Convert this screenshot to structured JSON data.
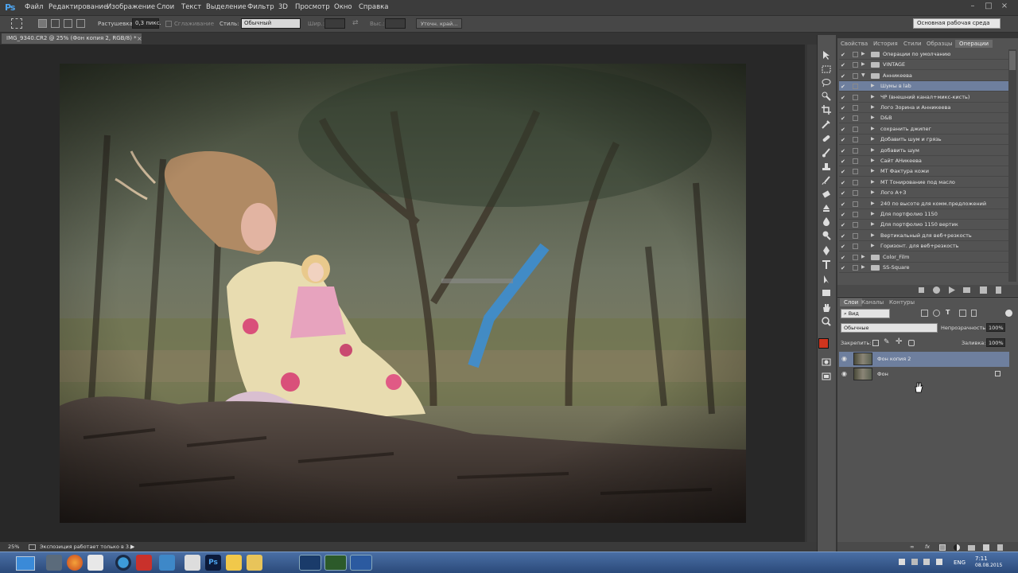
{
  "app": {
    "logo": "Ps"
  },
  "menu": [
    "Файл",
    "Редактирование",
    "Изображение",
    "Слои",
    "Текст",
    "Выделение",
    "Фильтр",
    "3D",
    "Просмотр",
    "Окно",
    "Справка"
  ],
  "options": {
    "feather_label": "Растушевка:",
    "feather_value": "0,3 пикс.",
    "antialias_label": "Сглаживание",
    "style_label": "Стиль:",
    "style_value": "Обычный",
    "width_label": "Шир.:",
    "height_label": "Выс.:",
    "refine_button": "Уточн. край...",
    "workspace": "Основная рабочая среда"
  },
  "document": {
    "tab_title": "IMG_9340.CR2 @ 25% (Фон копия 2, RGB/8) *",
    "close": "×"
  },
  "status": {
    "zoom": "25%",
    "message": "Экспозиция работает только в 3..."
  },
  "panel_tabs": [
    "Свойства",
    "История",
    "Стили",
    "Образцы",
    "Операции"
  ],
  "actions": [
    {
      "name": "Операции по умолчанию",
      "level": 0,
      "set": true,
      "open": false
    },
    {
      "name": "VINTAGE",
      "level": 0,
      "set": true,
      "open": false
    },
    {
      "name": "Анникеева",
      "level": 0,
      "set": true,
      "open": true
    },
    {
      "name": "Шумы в lab",
      "level": 1,
      "selected": true
    },
    {
      "name": "ЧР (внешний канал+микс-кисть)",
      "level": 1
    },
    {
      "name": "Лого Зорина и Анникеева",
      "level": 1
    },
    {
      "name": "D&B",
      "level": 1
    },
    {
      "name": "сохранить джипег",
      "level": 1
    },
    {
      "name": "Добавить шум и грязь",
      "level": 1
    },
    {
      "name": "добавить шум",
      "level": 1
    },
    {
      "name": "Сайт АНикеева",
      "level": 1
    },
    {
      "name": "МТ Фактура кожи",
      "level": 1
    },
    {
      "name": "МТ Тонирование под масло",
      "level": 1
    },
    {
      "name": "Лого А+З",
      "level": 1
    },
    {
      "name": "240 по высоте для комм.предложений",
      "level": 1
    },
    {
      "name": "Для портфолио 1150",
      "level": 1
    },
    {
      "name": "Для портфолио 1150 вертик",
      "level": 1
    },
    {
      "name": "Вертикальный для веб+резкость",
      "level": 1
    },
    {
      "name": "Горизонт. для веб+резкость",
      "level": 1
    },
    {
      "name": "Color_Film",
      "level": 0,
      "set": true,
      "open": false
    },
    {
      "name": "SS-Square",
      "level": 0,
      "set": true,
      "open": false
    }
  ],
  "layers_tabs": [
    "Слои",
    "Каналы",
    "Контуры"
  ],
  "layers": {
    "filter_kind": "Вид",
    "blend_mode": "Обычные",
    "opacity_label": "Непрозрачность:",
    "opacity": "100%",
    "lock_label": "Закрепить:",
    "fill_label": "Заливка:",
    "fill": "100%",
    "items": [
      {
        "name": "Фон копия 2",
        "selected": true,
        "locked": false
      },
      {
        "name": "Фон",
        "selected": false,
        "locked": true
      }
    ]
  },
  "taskbar": {
    "lang": "ENG",
    "time": "7:11",
    "date": "08.08.2015"
  },
  "colors": {
    "foreground": "#d0351e",
    "background": "#e6e6e6",
    "selection": "#6e7f9e",
    "accent": "#4ea5f0"
  },
  "icons": [
    "move-icon",
    "marquee-icon",
    "lasso-icon",
    "quick-select-icon",
    "crop-icon",
    "eyedropper-icon",
    "healing-icon",
    "brush-icon",
    "stamp-icon",
    "history-brush-icon",
    "eraser-icon",
    "gradient-icon",
    "blur-icon",
    "dodge-icon",
    "pen-icon",
    "type-icon",
    "path-select-icon",
    "shape-icon",
    "hand-icon",
    "zoom-icon"
  ]
}
